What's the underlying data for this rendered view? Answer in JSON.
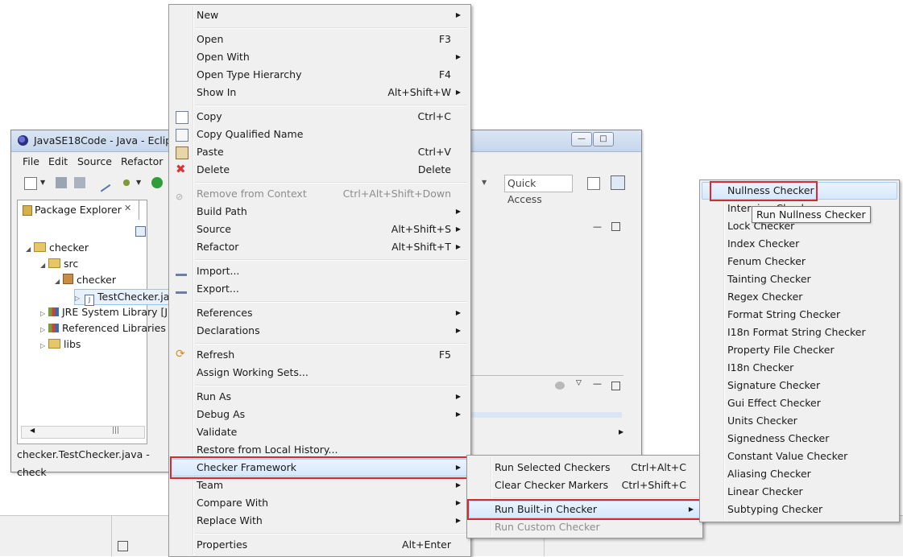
{
  "eclipse": {
    "title": "JavaSE18Code - Java - Eclipse",
    "menubar": [
      "File",
      "Edit",
      "Source",
      "Refactor"
    ],
    "quick_access": "Quick Access",
    "package_explorer_tab": "Package Explorer",
    "tree": [
      {
        "label": "checker",
        "depth": 0,
        "icon": "project-icon",
        "expanded": true
      },
      {
        "label": "src",
        "depth": 1,
        "icon": "src-folder-icon",
        "expanded": true
      },
      {
        "label": "checker",
        "depth": 2,
        "icon": "package-icon",
        "expanded": true
      },
      {
        "label": "TestChecker.ja",
        "depth": 3,
        "icon": "java-file-icon",
        "selected": true
      },
      {
        "label": "JRE System Library [J",
        "depth": 1,
        "icon": "library-icon"
      },
      {
        "label": "Referenced Libraries",
        "depth": 1,
        "icon": "library-icon"
      },
      {
        "label": "libs",
        "depth": 1,
        "icon": "folder-icon"
      }
    ],
    "status_text": "checker.TestChecker.java - check"
  },
  "context_menu": {
    "items": [
      {
        "label": "New",
        "shortcut": "",
        "submenu": true
      },
      {
        "label": "Open",
        "shortcut": "F3"
      },
      {
        "label": "Open With",
        "shortcut": "",
        "submenu": true
      },
      {
        "label": "Open Type Hierarchy",
        "shortcut": "F4"
      },
      {
        "label": "Show In",
        "shortcut": "Alt+Shift+W",
        "submenu": true
      },
      {
        "label": "Copy",
        "shortcut": "Ctrl+C"
      },
      {
        "label": "Copy Qualified Name",
        "shortcut": ""
      },
      {
        "label": "Paste",
        "shortcut": "Ctrl+V"
      },
      {
        "label": "Delete",
        "shortcut": "Delete"
      },
      {
        "label": "Remove from Context",
        "shortcut": "Ctrl+Alt+Shift+Down",
        "disabled": true
      },
      {
        "label": "Build Path",
        "shortcut": "",
        "submenu": true
      },
      {
        "label": "Source",
        "shortcut": "Alt+Shift+S",
        "submenu": true
      },
      {
        "label": "Refactor",
        "shortcut": "Alt+Shift+T",
        "submenu": true
      },
      {
        "label": "Import...",
        "shortcut": ""
      },
      {
        "label": "Export...",
        "shortcut": ""
      },
      {
        "label": "References",
        "shortcut": "",
        "submenu": true
      },
      {
        "label": "Declarations",
        "shortcut": "",
        "submenu": true
      },
      {
        "label": "Refresh",
        "shortcut": "F5"
      },
      {
        "label": "Assign Working Sets...",
        "shortcut": ""
      },
      {
        "label": "Run As",
        "shortcut": "",
        "submenu": true
      },
      {
        "label": "Debug As",
        "shortcut": "",
        "submenu": true
      },
      {
        "label": "Validate",
        "shortcut": ""
      },
      {
        "label": "Restore from Local History...",
        "shortcut": ""
      },
      {
        "label": "Checker Framework",
        "shortcut": "",
        "submenu": true,
        "highlighted": true
      },
      {
        "label": "Team",
        "shortcut": "",
        "submenu": true
      },
      {
        "label": "Compare With",
        "shortcut": "",
        "submenu": true
      },
      {
        "label": "Replace With",
        "shortcut": "",
        "submenu": true
      },
      {
        "label": "Properties",
        "shortcut": "Alt+Enter"
      }
    ]
  },
  "checker_submenu": {
    "items": [
      {
        "label": "Run Selected Checkers",
        "shortcut": "Ctrl+Alt+C"
      },
      {
        "label": "Clear Checker Markers",
        "shortcut": "Ctrl+Shift+C"
      },
      {
        "label": "Run Built-in Checker",
        "shortcut": "",
        "submenu": true,
        "highlighted": true
      },
      {
        "label": "Run Custom Checker",
        "shortcut": "",
        "disabled": true
      }
    ]
  },
  "builtin_submenu": {
    "items": [
      "Nullness Checker",
      "Interning Checker",
      "Lock Checker",
      "Index Checker",
      "Fenum Checker",
      "Tainting Checker",
      "Regex Checker",
      "Format String Checker",
      "I18n Format String Checker",
      "Property File Checker",
      "I18n Checker",
      "Signature Checker",
      "Gui Effect Checker",
      "Units Checker",
      "Signedness Checker",
      "Constant Value Checker",
      "Aliasing Checker",
      "Linear Checker",
      "Subtyping Checker"
    ],
    "tooltip": "Run Nullness Checker"
  },
  "colors": {
    "highlight_border": "#d42a32",
    "hover_blue": "#d6e8fb",
    "menu_bg": "#f0f0f0"
  }
}
